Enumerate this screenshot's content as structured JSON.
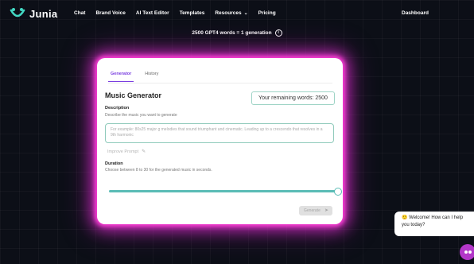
{
  "brand": {
    "name": "Junia"
  },
  "nav": {
    "links": [
      "Chat",
      "Brand Voice",
      "AI Text Editor",
      "Templates",
      "Resources",
      "Pricing"
    ],
    "dashboard": "Dashboard"
  },
  "banner": {
    "text": "2500 GPT4 words = 1 generation"
  },
  "tabs": [
    {
      "label": "Generator",
      "active": true
    },
    {
      "label": "History",
      "active": false
    }
  ],
  "form": {
    "title": "Music Generator",
    "remaining": "Your remaining words: 2500",
    "description_label": "Description",
    "description_help": "Describe the music you want to generate",
    "description_placeholder": "For example: 80s25 major g melodies that sound triumphant and cinematic. Leading up to a crescendo that resolves in a 9th harmonic",
    "improve_prompt": "Improve Prompt",
    "duration_label": "Duration",
    "duration_help": "Choose between 8 to 30 for the generated music in seconds.",
    "duration_value": 30,
    "generate_label": "Generate"
  },
  "chat": {
    "welcome": "Welcome! How can I help you today?"
  },
  "colors": {
    "accent": "#7a3ee0",
    "glow": "#ff3fd8",
    "teal": "#5bbcb6",
    "launcher": "#b337c9"
  }
}
